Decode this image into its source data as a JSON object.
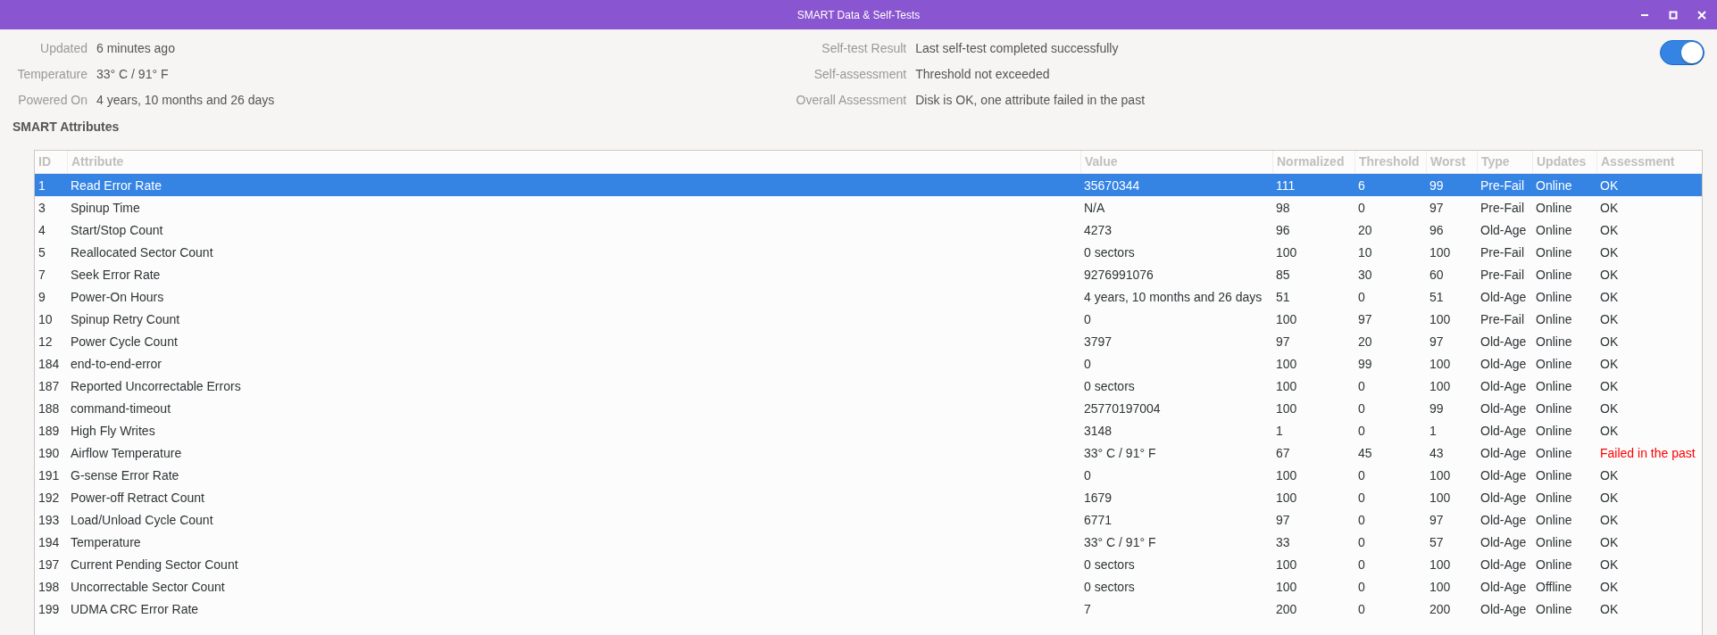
{
  "window": {
    "title": "SMART Data & Self-Tests"
  },
  "summary_left": [
    {
      "label": "Updated",
      "value": "6 minutes ago"
    },
    {
      "label": "Temperature",
      "value": "33° C / 91° F"
    },
    {
      "label": "Powered On",
      "value": "4 years, 10 months and 26 days"
    }
  ],
  "summary_right": [
    {
      "label": "Self-test Result",
      "value": "Last self-test completed successfully"
    },
    {
      "label": "Self-assessment",
      "value": "Threshold not exceeded"
    },
    {
      "label": "Overall Assessment",
      "value": "Disk is OK, one attribute failed in the past"
    }
  ],
  "smart_toggle": {
    "on": true
  },
  "section_title": "SMART Attributes",
  "table": {
    "columns": [
      "ID",
      "Attribute",
      "Value",
      "Normalized",
      "Threshold",
      "Worst",
      "Type",
      "Updates",
      "Assessment"
    ],
    "rows": [
      {
        "cells": [
          "1",
          "Read Error Rate",
          "35670344",
          "111",
          "6",
          "99",
          "Pre-Fail",
          "Online",
          "OK"
        ],
        "selected": true,
        "failed": false
      },
      {
        "cells": [
          "3",
          "Spinup Time",
          "N/A",
          "98",
          "0",
          "97",
          "Pre-Fail",
          "Online",
          "OK"
        ],
        "selected": false,
        "failed": false
      },
      {
        "cells": [
          "4",
          "Start/Stop Count",
          "4273",
          "96",
          "20",
          "96",
          "Old-Age",
          "Online",
          "OK"
        ],
        "selected": false,
        "failed": false
      },
      {
        "cells": [
          "5",
          "Reallocated Sector Count",
          "0 sectors",
          "100",
          "10",
          "100",
          "Pre-Fail",
          "Online",
          "OK"
        ],
        "selected": false,
        "failed": false
      },
      {
        "cells": [
          "7",
          "Seek Error Rate",
          "9276991076",
          "85",
          "30",
          "60",
          "Pre-Fail",
          "Online",
          "OK"
        ],
        "selected": false,
        "failed": false
      },
      {
        "cells": [
          "9",
          "Power-On Hours",
          "4 years, 10 months and 26 days",
          "51",
          "0",
          "51",
          "Old-Age",
          "Online",
          "OK"
        ],
        "selected": false,
        "failed": false
      },
      {
        "cells": [
          "10",
          "Spinup Retry Count",
          "0",
          "100",
          "97",
          "100",
          "Pre-Fail",
          "Online",
          "OK"
        ],
        "selected": false,
        "failed": false
      },
      {
        "cells": [
          "12",
          "Power Cycle Count",
          "3797",
          "97",
          "20",
          "97",
          "Old-Age",
          "Online",
          "OK"
        ],
        "selected": false,
        "failed": false
      },
      {
        "cells": [
          "184",
          "end-to-end-error",
          "0",
          "100",
          "99",
          "100",
          "Old-Age",
          "Online",
          "OK"
        ],
        "selected": false,
        "failed": false
      },
      {
        "cells": [
          "187",
          "Reported Uncorrectable Errors",
          "0 sectors",
          "100",
          "0",
          "100",
          "Old-Age",
          "Online",
          "OK"
        ],
        "selected": false,
        "failed": false
      },
      {
        "cells": [
          "188",
          "command-timeout",
          "25770197004",
          "100",
          "0",
          "99",
          "Old-Age",
          "Online",
          "OK"
        ],
        "selected": false,
        "failed": false
      },
      {
        "cells": [
          "189",
          "High Fly Writes",
          "3148",
          "1",
          "0",
          "1",
          "Old-Age",
          "Online",
          "OK"
        ],
        "selected": false,
        "failed": false
      },
      {
        "cells": [
          "190",
          "Airflow Temperature",
          "33° C / 91° F",
          "67",
          "45",
          "43",
          "Old-Age",
          "Online",
          "Failed in the past"
        ],
        "selected": false,
        "failed": true
      },
      {
        "cells": [
          "191",
          "G-sense Error Rate",
          "0",
          "100",
          "0",
          "100",
          "Old-Age",
          "Online",
          "OK"
        ],
        "selected": false,
        "failed": false
      },
      {
        "cells": [
          "192",
          "Power-off Retract Count",
          "1679",
          "100",
          "0",
          "100",
          "Old-Age",
          "Online",
          "OK"
        ],
        "selected": false,
        "failed": false
      },
      {
        "cells": [
          "193",
          "Load/Unload Cycle Count",
          "6771",
          "97",
          "0",
          "97",
          "Old-Age",
          "Online",
          "OK"
        ],
        "selected": false,
        "failed": false
      },
      {
        "cells": [
          "194",
          "Temperature",
          "33° C / 91° F",
          "33",
          "0",
          "57",
          "Old-Age",
          "Online",
          "OK"
        ],
        "selected": false,
        "failed": false
      },
      {
        "cells": [
          "197",
          "Current Pending Sector Count",
          "0 sectors",
          "100",
          "0",
          "100",
          "Old-Age",
          "Online",
          "OK"
        ],
        "selected": false,
        "failed": false
      },
      {
        "cells": [
          "198",
          "Uncorrectable Sector Count",
          "0 sectors",
          "100",
          "0",
          "100",
          "Old-Age",
          "Offline",
          "OK"
        ],
        "selected": false,
        "failed": false
      },
      {
        "cells": [
          "199",
          "UDMA CRC Error Rate",
          "7",
          "200",
          "0",
          "200",
          "Old-Age",
          "Online",
          "OK"
        ],
        "selected": false,
        "failed": false
      }
    ]
  }
}
